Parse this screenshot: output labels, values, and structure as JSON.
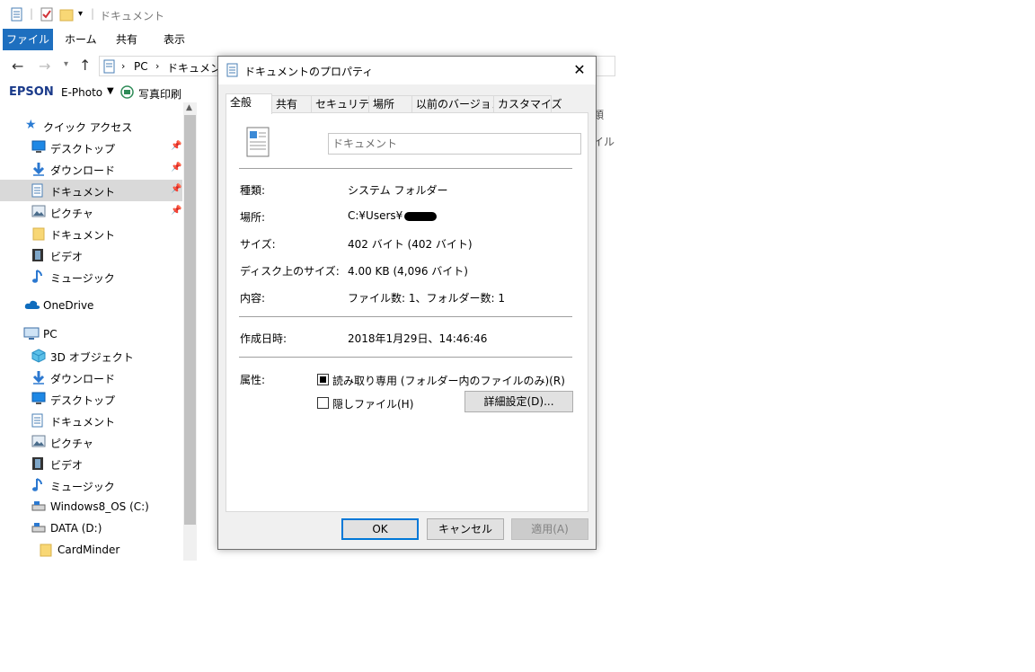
{
  "explorer": {
    "quick_access_title": "ドキュメント",
    "ribbon_tabs": [
      "ファイル",
      "ホーム",
      "共有",
      "表示"
    ],
    "address_path": [
      "PC",
      "ドキュメント"
    ],
    "epson_brand": "EPSON",
    "epson_ephoto": "E-Photo",
    "epson_print": "写真印刷",
    "right_partial": [
      "類",
      "イル"
    ],
    "nav": {
      "quick_access": "クイック アクセス",
      "qa_items": [
        {
          "label": "デスクトップ",
          "icon": "desktop-icon"
        },
        {
          "label": "ダウンロード",
          "icon": "download-icon"
        },
        {
          "label": "ドキュメント",
          "icon": "document-icon"
        },
        {
          "label": "ピクチャ",
          "icon": "picture-icon"
        },
        {
          "label": "ドキュメント",
          "icon": "folder-icon"
        },
        {
          "label": "ビデオ",
          "icon": "video-icon"
        },
        {
          "label": "ミュージック",
          "icon": "music-icon"
        }
      ],
      "onedrive": "OneDrive",
      "pc": "PC",
      "pc_items": [
        {
          "label": "3D オブジェクト",
          "icon": "3d-objects-icon"
        },
        {
          "label": "ダウンロード",
          "icon": "download-icon"
        },
        {
          "label": "デスクトップ",
          "icon": "desktop-icon"
        },
        {
          "label": "ドキュメント",
          "icon": "document-icon"
        },
        {
          "label": "ピクチャ",
          "icon": "picture-icon"
        },
        {
          "label": "ビデオ",
          "icon": "video-icon"
        },
        {
          "label": "ミュージック",
          "icon": "music-icon"
        },
        {
          "label": "Windows8_OS (C:)",
          "icon": "drive-icon"
        },
        {
          "label": "DATA (D:)",
          "icon": "drive-icon"
        },
        {
          "label": "CardMinder",
          "icon": "folder-icon"
        }
      ]
    }
  },
  "dialog": {
    "title": "ドキュメントのプロパティ",
    "tabs": [
      "全般",
      "共有",
      "セキュリティ",
      "場所",
      "以前のバージョン",
      "カスタマイズ"
    ],
    "name_field": "ドキュメント",
    "props": {
      "type_label": "種類:",
      "type_value": "システム フォルダー",
      "location_label": "場所:",
      "location_value": "C:¥Users¥",
      "size_label": "サイズ:",
      "size_value": "402 バイト (402 バイト)",
      "disk_size_label": "ディスク上のサイズ:",
      "disk_size_value": "4.00 KB (4,096 バイト)",
      "contents_label": "内容:",
      "contents_value": "ファイル数: 1、フォルダー数: 1",
      "created_label": "作成日時:",
      "created_value": "2018年1月29日、14:46:46",
      "attributes_label": "属性:",
      "readonly_label": "読み取り専用 (フォルダー内のファイルのみ)(R)",
      "hidden_label": "隠しファイル(H)",
      "advanced_button": "詳細設定(D)..."
    },
    "buttons": {
      "ok": "OK",
      "cancel": "キャンセル",
      "apply": "適用(A)"
    },
    "colors": {
      "accent": "#0078d7",
      "ribbon_file": "#1e6fbf"
    }
  }
}
